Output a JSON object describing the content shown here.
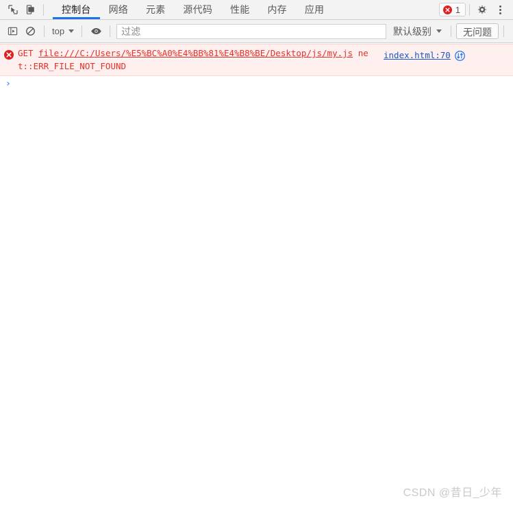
{
  "window": {
    "app": "Chrome DevTools",
    "accent_color": "#1a73e8",
    "error_color": "#e8302a",
    "link_color": "#1a56c4"
  },
  "tabbar": {
    "inspect_icon": "inspect-element-icon",
    "device_icon": "device-toolbar-icon",
    "tabs": [
      {
        "label": "控制台",
        "active": true
      },
      {
        "label": "网络",
        "active": false
      },
      {
        "label": "元素",
        "active": false
      },
      {
        "label": "源代码",
        "active": false
      },
      {
        "label": "性能",
        "active": false
      },
      {
        "label": "内存",
        "active": false
      },
      {
        "label": "应用",
        "active": false
      }
    ],
    "error_badge": {
      "icon": "error-circle-icon",
      "count": "1"
    },
    "settings_icon": "gear-icon",
    "more_icon": "more-vertical-icon"
  },
  "console_toolbar": {
    "sidebar_toggle_icon": "console-sidebar-icon",
    "clear_icon": "clear-console-icon",
    "context": {
      "label": "top",
      "caret": "chevron-down-icon"
    },
    "live_expression_icon": "eye-icon",
    "filter": {
      "value": "",
      "placeholder": "过滤"
    },
    "levels": {
      "label": "默认级别",
      "caret": "chevron-down-icon"
    },
    "issues_label": "无问题"
  },
  "console": {
    "messages": [
      {
        "type": "error",
        "icon": "error-circle-icon",
        "method": "GET ",
        "url": "file:///C:/Users/%E5%BC%A0%E4%BB%81%E4%B8%BE/Desktop/js/my.js",
        "detail": " net::ERR_FILE_NOT_FOUND",
        "source": "index.html:70",
        "network_icon": "network-request-icon"
      }
    ],
    "prompt": {
      "caret": "›",
      "value": ""
    }
  },
  "watermark": {
    "text": "CSDN @昔日_少年"
  }
}
